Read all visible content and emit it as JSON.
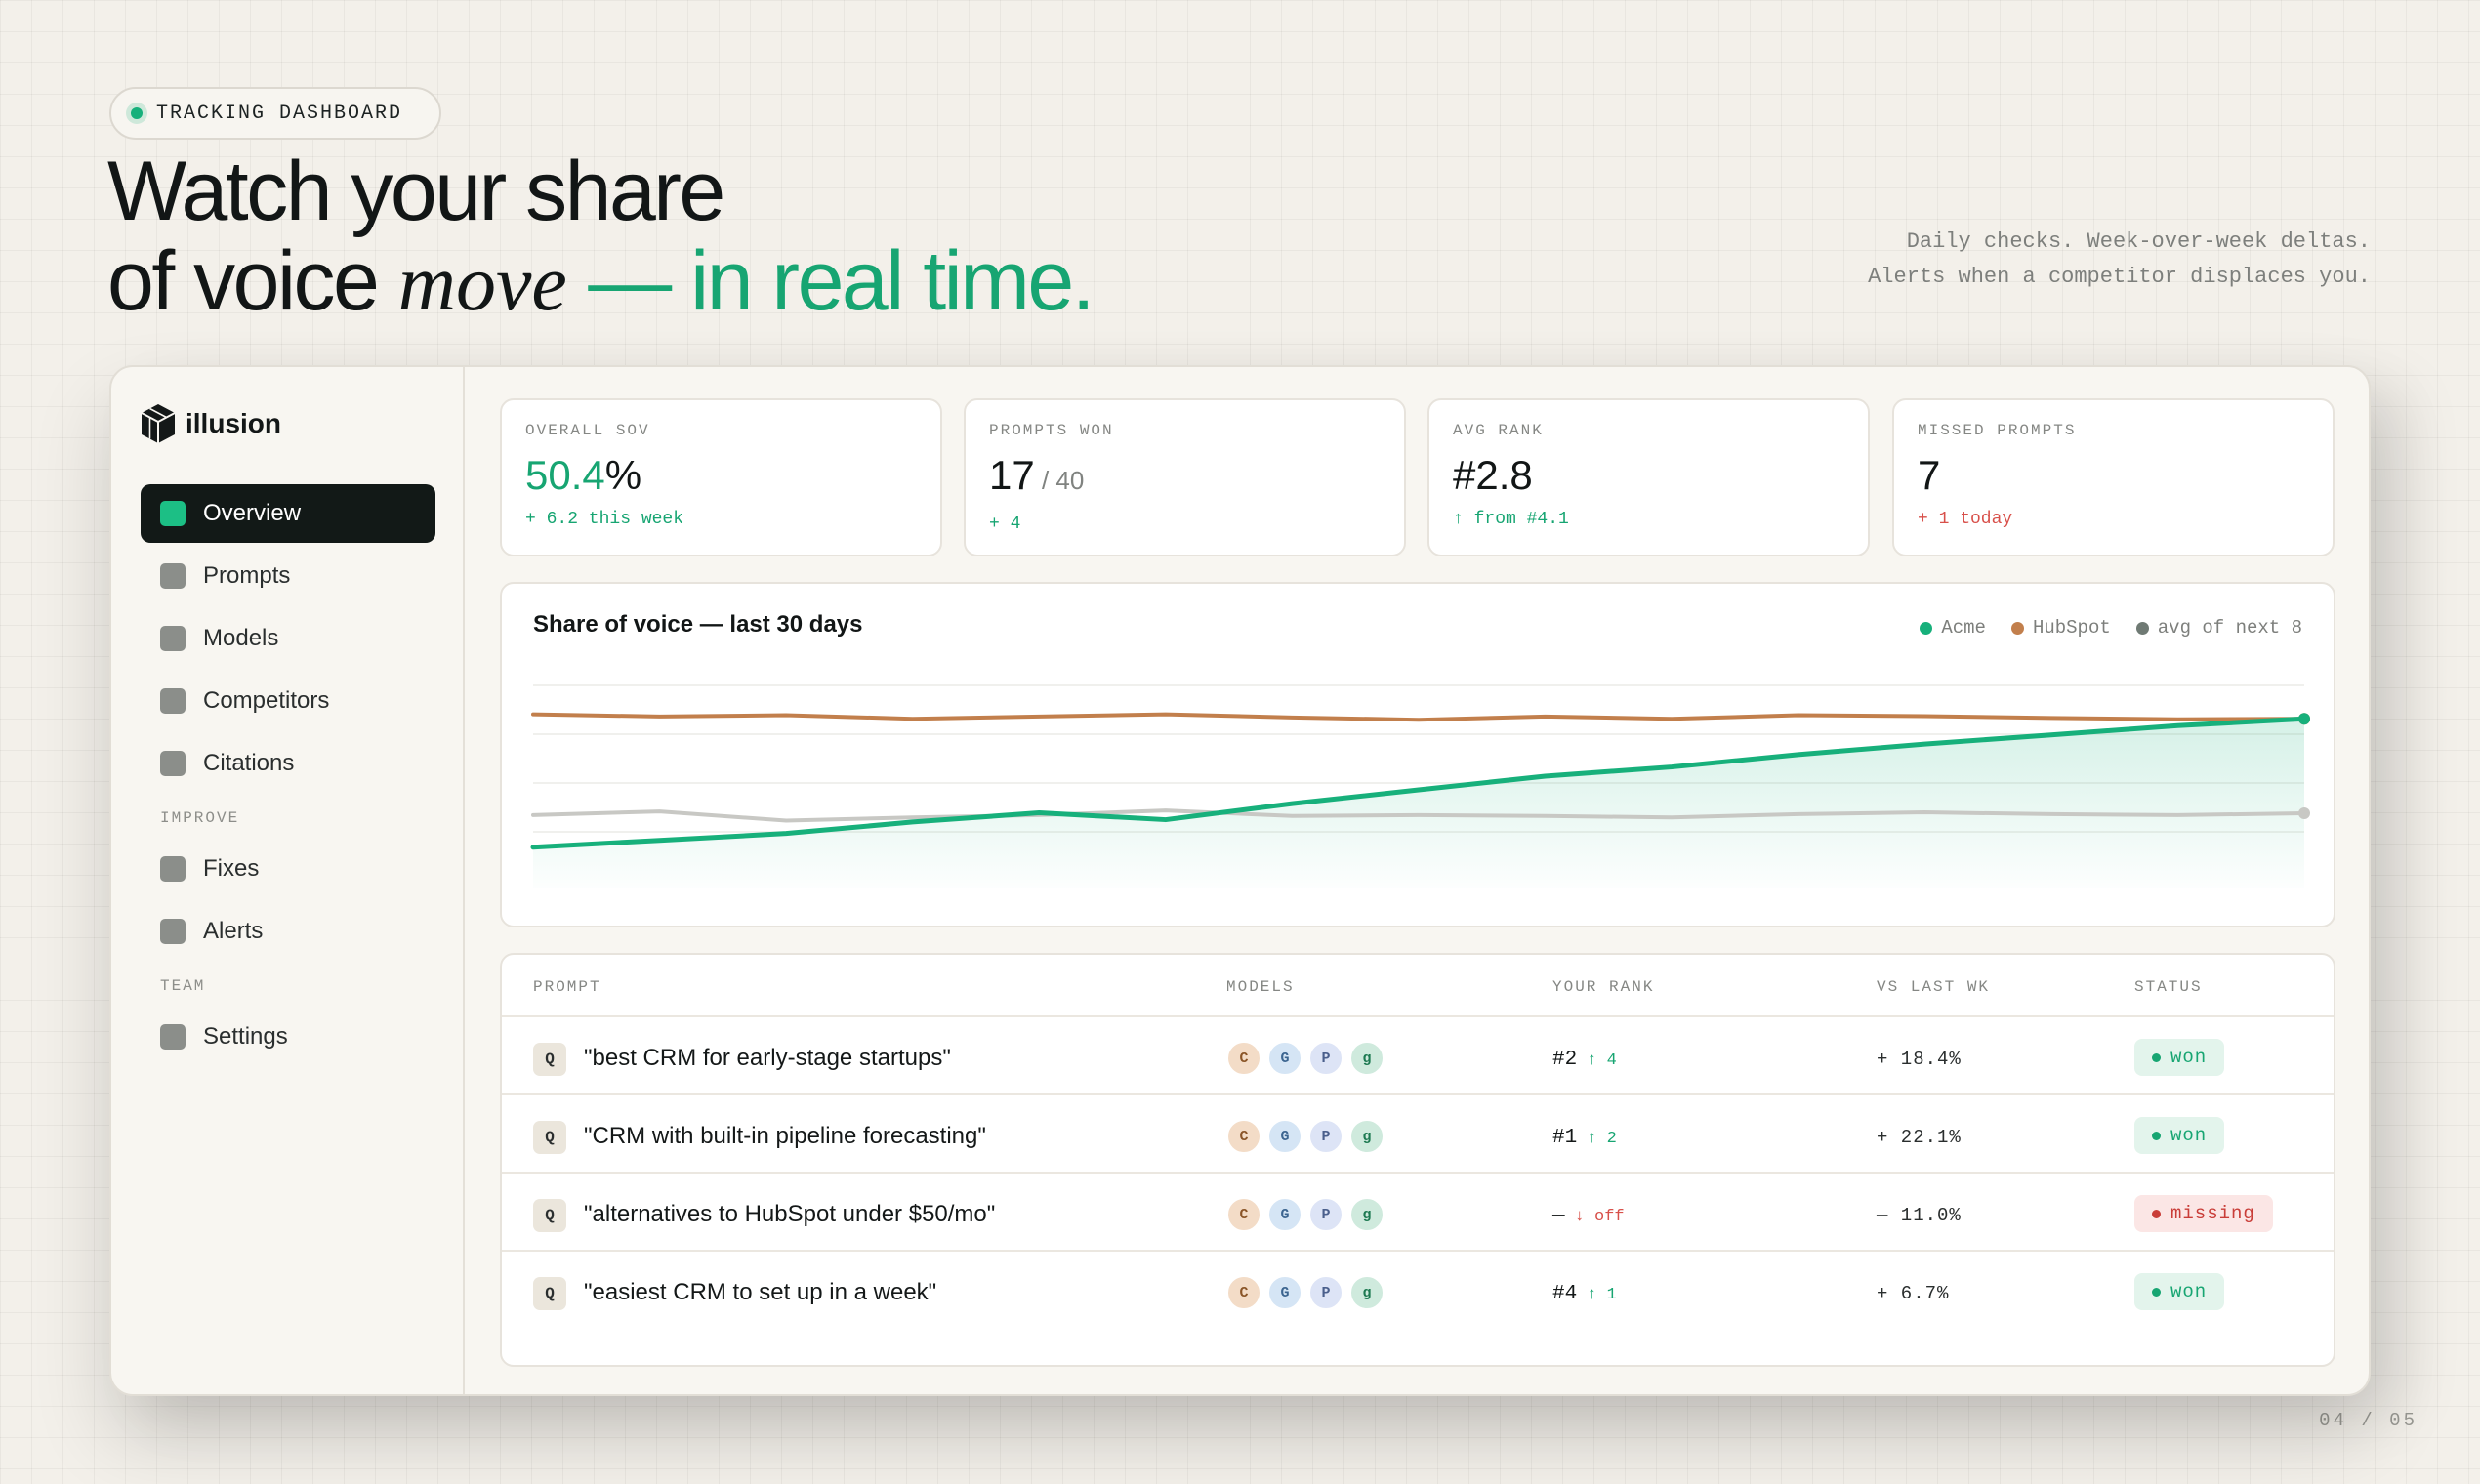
{
  "header": {
    "pill_label": "TRACKING DASHBOARD",
    "headline_line1": "Watch your share",
    "headline_line2_prefix": "of voice ",
    "headline_emphasis": "move",
    "headline_line2_suffix": "— in real time.",
    "subcopy": "Daily checks. Week-over-week deltas. Alerts when a competitor displaces you.",
    "page_indicator": "04 / 05"
  },
  "brand": {
    "name": "illusion"
  },
  "sidebar": {
    "items": [
      {
        "label": "Overview",
        "active": true
      },
      {
        "label": "Prompts"
      },
      {
        "label": "Models"
      },
      {
        "label": "Competitors"
      },
      {
        "label": "Citations"
      }
    ],
    "section_improve": "IMPROVE",
    "improve_items": [
      {
        "label": "Fixes"
      },
      {
        "label": "Alerts"
      }
    ],
    "section_team": "TEAM",
    "team_items": [
      {
        "label": "Settings"
      }
    ]
  },
  "stats": [
    {
      "label": "OVERALL SOV",
      "value": "50.4",
      "value_suffix": "%",
      "delta": "+ 6.2 this week",
      "delta_color": "green"
    },
    {
      "label": "PROMPTS WON",
      "value": "17",
      "value_suffix": " / 40",
      "delta": "+ 4",
      "delta_color": "green"
    },
    {
      "label": "AVG RANK",
      "value": "#2.8",
      "value_suffix": "",
      "delta": "↑ from #4.1",
      "delta_color": "green"
    },
    {
      "label": "MISSED PROMPTS",
      "value": "7",
      "value_suffix": "",
      "delta": "+ 1 today",
      "delta_color": "red"
    }
  ],
  "chart": {
    "title": "Share of voice — last 30 days",
    "legend": [
      {
        "name": "Acme",
        "color": "#17b07b"
      },
      {
        "name": "HubSpot",
        "color": "#c27f4c"
      },
      {
        "name": "avg of next 8",
        "color": "#6f7a74"
      }
    ]
  },
  "chart_data": {
    "type": "line",
    "title": "Share of voice — last 30 days",
    "x": [
      0,
      1,
      2,
      3,
      4,
      5,
      6,
      7,
      8,
      9,
      10,
      11,
      12,
      13,
      14
    ],
    "series": [
      {
        "name": "HubSpot",
        "color": "#c27f4c",
        "values": [
          58,
          57.5,
          57.8,
          57,
          57.5,
          58,
          57.3,
          56.8,
          57.5,
          57,
          57.8,
          57.6,
          57.2,
          56.9,
          57
        ]
      },
      {
        "name": "avg of next 8",
        "color": "#c8c8c4",
        "values": [
          36,
          36.8,
          34.8,
          35.5,
          36,
          37,
          35.8,
          36,
          35.8,
          35.5,
          36.2,
          36.6,
          36.2,
          36,
          36.4
        ]
      },
      {
        "name": "Acme",
        "color": "#17b07b",
        "values": [
          29,
          30.5,
          32,
          34.5,
          36.5,
          35,
          38.5,
          41.5,
          44.5,
          46.5,
          49.2,
          51.5,
          53.5,
          55.5,
          57
        ]
      }
    ],
    "ylim": [
      20,
      66
    ],
    "grid": true,
    "legend_placement": "top-right",
    "area_under": "Acme"
  },
  "table": {
    "headers": {
      "prompt": "PROMPT",
      "models": "MODELS",
      "rank": "YOUR RANK",
      "vs": "VS LAST WK",
      "status": "STATUS"
    },
    "rows": [
      {
        "icon": "Q",
        "prompt": "\"best CRM for early-stage startups\"",
        "models": [
          "C",
          "G",
          "P",
          "g"
        ],
        "rank": "#2",
        "rank_delta": "↑ 4",
        "rank_dir": "up",
        "vs": "+ 18.4%",
        "status": "won"
      },
      {
        "icon": "Q",
        "prompt": "\"CRM with built-in pipeline forecasting\"",
        "models": [
          "C",
          "G",
          "P",
          "g"
        ],
        "rank": "#1",
        "rank_delta": "↑ 2",
        "rank_dir": "up",
        "vs": "+ 22.1%",
        "status": "won"
      },
      {
        "icon": "Q",
        "prompt": "\"alternatives to HubSpot under $50/mo\"",
        "models": [
          "C",
          "G",
          "P",
          "g"
        ],
        "rank": "—",
        "rank_delta": "↓ off",
        "rank_dir": "down",
        "vs": "— 11.0%",
        "status": "missing"
      },
      {
        "icon": "Q",
        "prompt": "\"easiest CRM to set up in a week\"",
        "models": [
          "C",
          "G",
          "P",
          "g"
        ],
        "rank": "#4",
        "rank_delta": "↑ 1",
        "rank_dir": "up",
        "vs": "+ 6.7%",
        "status": "won"
      }
    ]
  }
}
